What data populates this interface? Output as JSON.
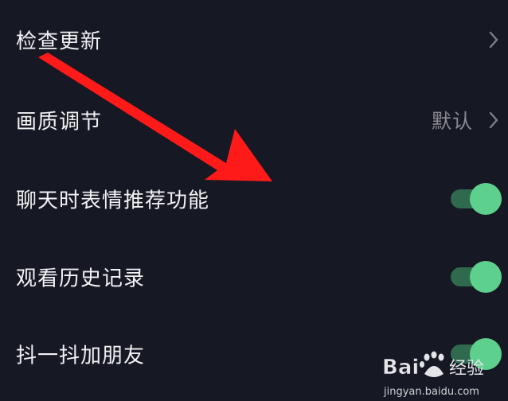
{
  "settings": {
    "items": [
      {
        "label": "检查更新",
        "value": "",
        "control": "chevron"
      },
      {
        "label": "画质调节",
        "value": "默认",
        "control": "chevron"
      },
      {
        "label": "聊天时表情推荐功能",
        "value": "",
        "control": "toggle",
        "on": true
      },
      {
        "label": "观看历史记录",
        "value": "",
        "control": "toggle",
        "on": true
      },
      {
        "label": "抖一抖加朋友",
        "value": "",
        "control": "toggle",
        "on": true
      }
    ]
  },
  "watermark": {
    "brand": "Bai 经验",
    "url": "jingyan.baidu.com"
  },
  "colors": {
    "background": "#161823",
    "text": "#f2f2f4",
    "secondary_text": "#8a8b91",
    "toggle_on_knob": "#5dd08e",
    "toggle_on_track": "#2f6a4f",
    "annotation_arrow": "#ff1a1a"
  },
  "icons": {
    "chevron": "chevron-right-icon",
    "arrow": "red-arrow-annotation-icon",
    "paw": "baidu-paw-logo-icon"
  }
}
